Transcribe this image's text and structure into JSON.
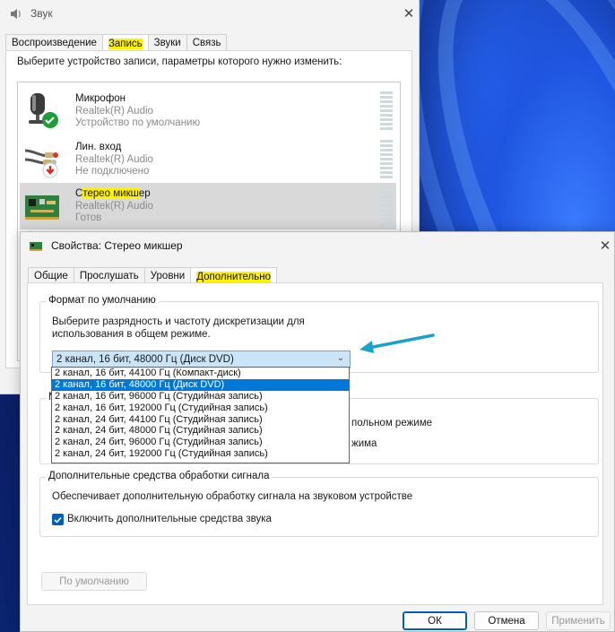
{
  "sound_window": {
    "title": "Звук",
    "tabs": [
      {
        "label": "Воспроизведение",
        "active": false
      },
      {
        "label": "Запись",
        "active": true
      },
      {
        "label": "Звуки",
        "active": false
      },
      {
        "label": "Связь",
        "active": false
      }
    ],
    "prompt": "Выберите устройство записи, параметры которого нужно изменить:",
    "devices": [
      {
        "name": "Микрофон",
        "driver": "Realtek(R) Audio",
        "status": "Устройство по умолчанию",
        "icon": "microphone-icon",
        "badge": "green-check-icon",
        "selected": false
      },
      {
        "name": "Лин. вход",
        "driver": "Realtek(R) Audio",
        "status": "Не подключено",
        "icon": "line-in-cable-icon",
        "badge": "red-down-arrow-icon",
        "selected": false
      },
      {
        "name_prefix": "С",
        "name_highlight": "тер",
        "name_rest": "ео микш",
        "name_suffix": "ер",
        "name": "Стерео микшер",
        "driver": "Realtek(R) Audio",
        "status": "Готов",
        "icon": "circuit-board-icon",
        "badge": "",
        "selected": true
      }
    ]
  },
  "props_window": {
    "title": "Свойства: Стерео микшер",
    "tabs": [
      {
        "label": "Общие",
        "active": false
      },
      {
        "label": "Прослушать",
        "active": false
      },
      {
        "label": "Уровни",
        "active": false
      },
      {
        "label": "Дополнительно",
        "active": true
      }
    ],
    "default_format": {
      "group_title": "Формат по умолчанию",
      "description_line1": "Выберите разрядность и частоту дискретизации для",
      "description_line2": "использования в общем режиме.",
      "selected": "2 канал, 16 бит, 48000 Гц (Диск DVD)",
      "options": [
        "2 канал, 16 бит, 44100 Гц (Компакт-диск)",
        "2 канал, 16 бит, 48000 Гц (Диск DVD)",
        "2 канал, 16 бит, 96000 Гц (Студийная запись)",
        "2 канал, 16 бит, 192000 Гц (Студийная запись)",
        "2 канал, 24 бит, 44100 Гц (Студийная запись)",
        "2 канал, 24 бит, 48000 Гц (Студийная запись)",
        "2 канал, 24 бит, 96000 Гц (Студийная запись)",
        "2 канал, 24 бит, 192000 Гц (Студийная запись)"
      ],
      "selected_index": 1
    },
    "exclusive_partial": {
      "group_title_partial": "М",
      "line1_partial": "польном режиме",
      "line2_partial": "жима"
    },
    "enhancements": {
      "group_title": "Дополнительные средства обработки сигнала",
      "description": "Обеспечивает дополнительную обработку сигнала на звуковом устройстве",
      "checkbox_label": "Включить дополнительные средства звука",
      "checked": true
    },
    "buttons": {
      "restore_default": "По умолчанию",
      "ok": "ОК",
      "cancel": "Отмена",
      "apply": "Применить"
    }
  },
  "colors": {
    "accent": "#005fb8",
    "dropdown_selection": "#0078d7",
    "highlight": "#fff200",
    "annotation_arrow": "#1aa3c8"
  }
}
